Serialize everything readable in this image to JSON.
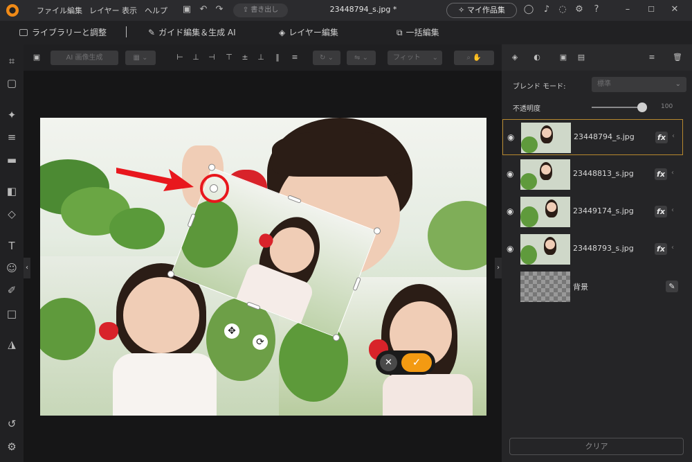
{
  "app": {
    "menu": [
      "ファイル",
      "編集",
      "レイヤー",
      "表示",
      "ヘルプ"
    ],
    "export_label": "書き出し",
    "document_title": "23448794_s.jpg *",
    "my_works_label": "マイ作品集"
  },
  "tabs": [
    "ライブラリーと調整",
    "ガイド編集＆生成 AI",
    "レイヤー編集",
    "一括編集"
  ],
  "toolbar": {
    "ai_generate_label": "AI 画像生成",
    "fit_label": "フィット"
  },
  "panel": {
    "blend_mode_label": "ブレンド モード:",
    "blend_mode_value": "標準",
    "opacity_label": "不透明度",
    "opacity_value": "100",
    "layers": [
      {
        "name": "23448794_s.jpg",
        "selected": true
      },
      {
        "name": "23448813_s.jpg",
        "selected": false
      },
      {
        "name": "23449174_s.jpg",
        "selected": false
      },
      {
        "name": "23448793_s.jpg",
        "selected": false
      },
      {
        "name": "背景",
        "selected": false
      }
    ],
    "fx_label": "fx",
    "clear_label": "クリア"
  },
  "colors": {
    "accent_orange": "#f39a12",
    "annotation_red": "#e8171d",
    "selection_border": "#b8892f"
  }
}
